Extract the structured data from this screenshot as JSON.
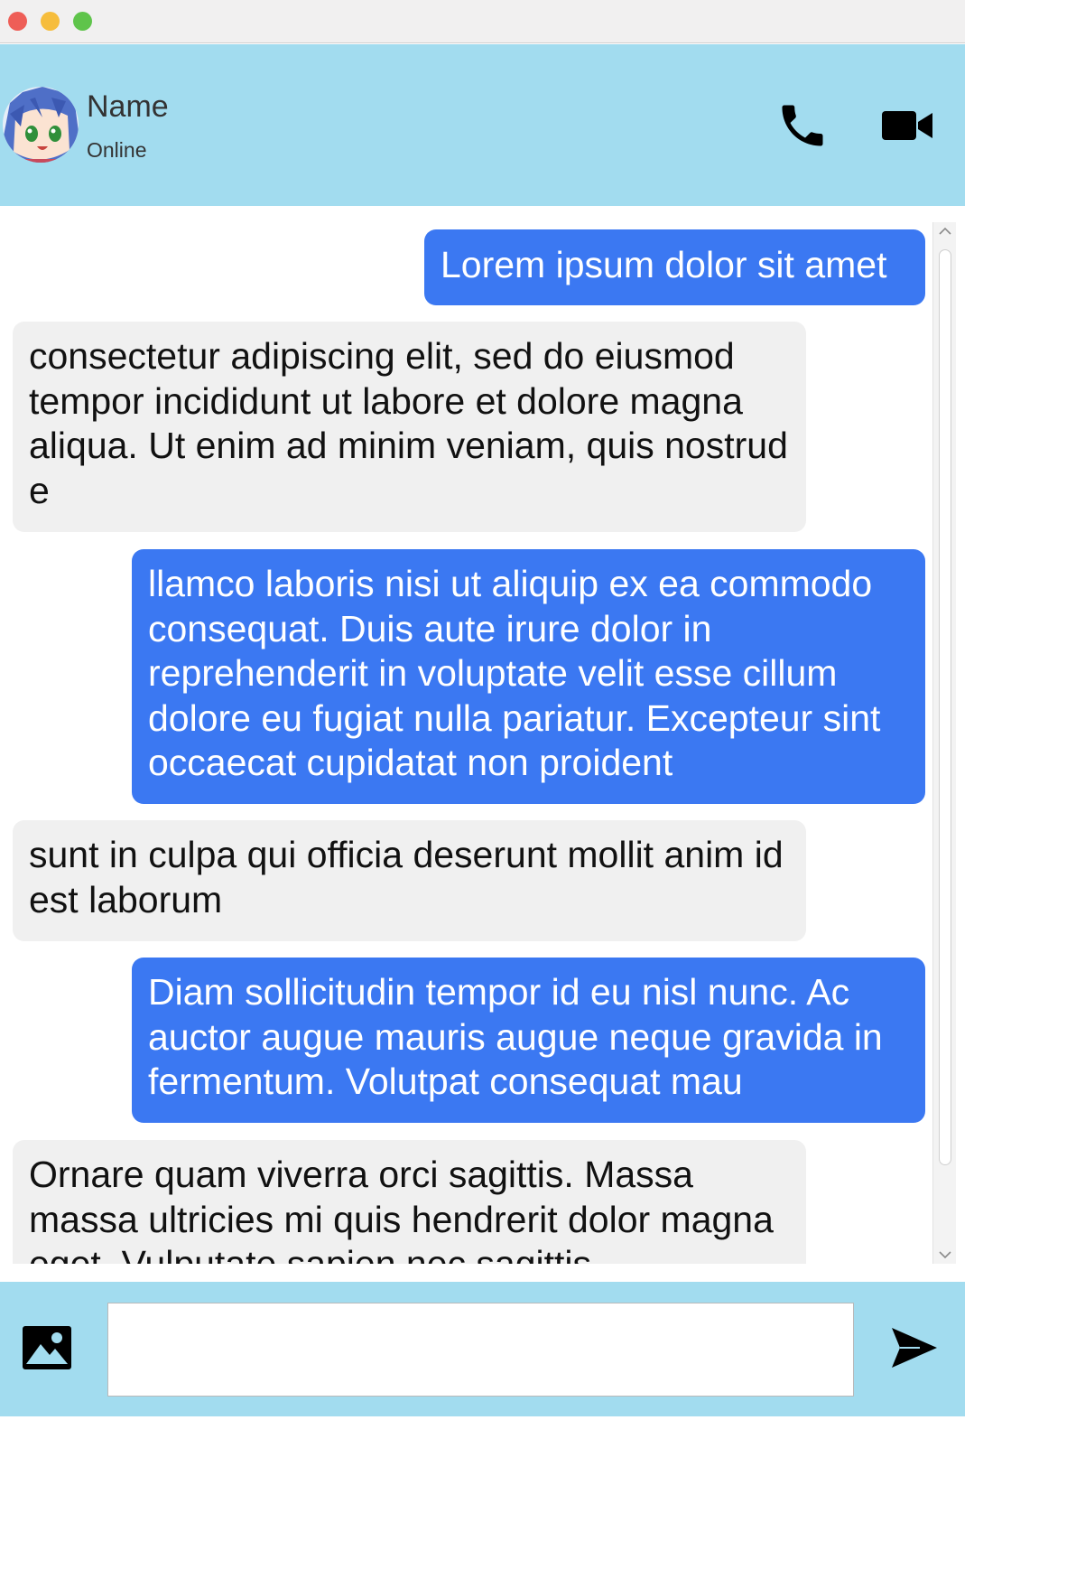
{
  "contact": {
    "name": "Name",
    "status": "Online"
  },
  "messages": [
    {
      "direction": "outgoing",
      "text": "Lorem ipsum dolor sit amet"
    },
    {
      "direction": "incoming",
      "text": "consectetur adipiscing elit, sed do eiusmod tempor incididunt ut labore et dolore magna aliqua. Ut enim ad minim veniam, quis nostrud e"
    },
    {
      "direction": "outgoing",
      "text": "llamco laboris nisi ut aliquip ex ea commodo consequat. Duis aute irure dolor in reprehenderit in voluptate velit esse cillum dolore eu fugiat nulla pariatur. Excepteur sint occaecat cupidatat non proident"
    },
    {
      "direction": "incoming",
      "text": "sunt in culpa qui officia deserunt mollit anim id est laborum"
    },
    {
      "direction": "outgoing",
      "text": "Diam sollicitudin tempor id eu nisl nunc. Ac auctor augue mauris augue neque gravida in fermentum. Volutpat consequat mau"
    },
    {
      "direction": "incoming",
      "text": "Ornare quam viverra orci sagittis. Massa massa ultricies mi quis hendrerit dolor magna eget. Vulputate sapien nec sagittis"
    }
  ],
  "composer": {
    "placeholder": "",
    "value": ""
  },
  "icons": {
    "call": "phone-icon",
    "video": "video-camera-icon",
    "attach": "image-icon",
    "send": "send-icon"
  },
  "colors": {
    "header_bg": "#a2dcef",
    "outgoing_bubble": "#3b78f2",
    "incoming_bubble": "#f0f0f0"
  }
}
